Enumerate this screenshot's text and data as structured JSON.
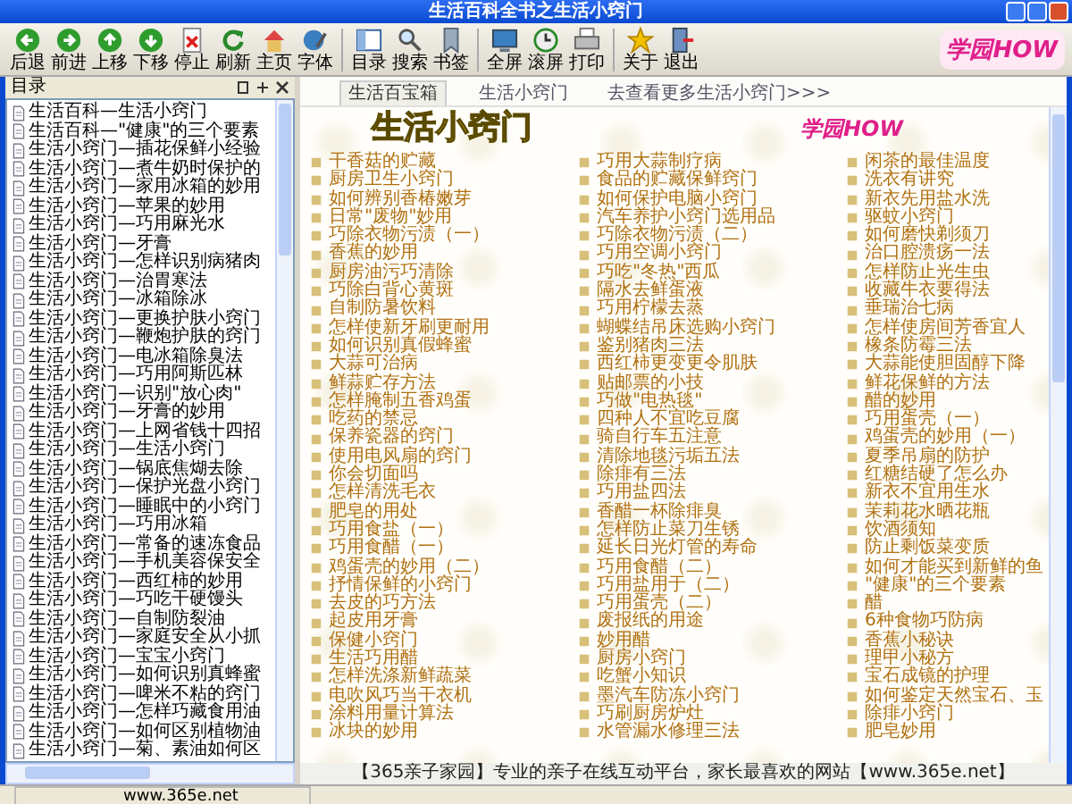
{
  "window": {
    "title": "生活百科全书之生活小窍门"
  },
  "toolbar": {
    "buttons": [
      {
        "label": "后退"
      },
      {
        "label": "前进"
      },
      {
        "label": "上移"
      },
      {
        "label": "下移"
      },
      {
        "label": "停止"
      },
      {
        "label": "刷新"
      },
      {
        "label": "主页"
      },
      {
        "label": "字体"
      },
      {
        "label": "目录"
      },
      {
        "label": "搜索"
      },
      {
        "label": "书签"
      },
      {
        "label": "全屏"
      },
      {
        "label": "滚屏"
      },
      {
        "label": "打印"
      },
      {
        "label": "关于"
      },
      {
        "label": "退出"
      }
    ],
    "logo": "学园HOW"
  },
  "sidebar": {
    "title": "目录",
    "items": [
      "生活百科—生活小窍门",
      "生活百科—\"健康\"的三个要素",
      "生活小窍门—插花保鲜小经验",
      "生活小窍门—煮牛奶时保护的",
      "生活小窍门—家用冰箱的妙用",
      "生活小窍门—苹果的妙用",
      "生活小窍门—巧用麻光水",
      "生活小窍门—牙膏",
      "生活小窍门—怎样识别病猪肉",
      "生活小窍门—治胃寒法",
      "生活小窍门—冰箱除冰",
      "生活小窍门—更换护肤小窍门",
      "生活小窍门—鞭炮护肤的窍门",
      "生活小窍门—电冰箱除臭法",
      "生活小窍门—巧用阿斯匹林",
      "生活小窍门—识别\"放心肉\"",
      "生活小窍门—牙膏的妙用",
      "生活小窍门—上网省钱十四招",
      "生活小窍门—生活小窍门",
      "生活小窍门—锅底焦煳去除",
      "生活小窍门—保护光盘小窍门",
      "生活小窍门—睡眠中的小窍门",
      "生活小窍门—巧用冰箱",
      "生活小窍门—常备的速冻食品",
      "生活小窍门—手机美容保安全",
      "生活小窍门—西红柿的妙用",
      "生活小窍门—巧吃干硬馒头",
      "生活小窍门—自制防裂油",
      "生活小窍门—家庭安全从小抓",
      "生活小窍门—宝宝小窍门",
      "生活小窍门—如何识别真蜂蜜",
      "生活小窍门—啤米不粘的窍门",
      "生活小窍门—怎样巧藏食用油",
      "生活小窍门—如何区别植物油",
      "生活小窍门—菊、素油如何区"
    ]
  },
  "tabs": [
    {
      "label": "生活百宝箱",
      "selected": true
    },
    {
      "label": "生活小窍门",
      "selected": false
    },
    {
      "label": "去查看更多生活小窍门>>>",
      "selected": false
    }
  ],
  "content": {
    "banner_title": "生活小窍门",
    "site_logo": "学园HOW",
    "columns": [
      [
        "干香菇的贮藏",
        "厨房卫生小窍门",
        "如何辨别香椿嫩芽",
        "日常\"废物\"妙用",
        "巧除衣物污渍（一）",
        "香蕉的妙用",
        "厨房油污巧清除",
        "巧除白背心黄斑",
        "自制防暑饮料",
        "怎样使新牙刷更耐用",
        "如何识别真假蜂蜜",
        "大蒜可治病",
        "鲜蒜贮存方法",
        "怎样腌制五香鸡蛋",
        "吃药的禁忌",
        "保养瓷器的窍门",
        "使用电风扇的窍门",
        "你会切面吗",
        "怎样清洗毛衣",
        "肥皂的用处",
        "巧用食盐（一）",
        "巧用食醋（一）",
        "鸡蛋壳的妙用（二）",
        "抒情保鲜的小窍门",
        "去皮的巧方法",
        "起皮用牙膏",
        "保健小窍门",
        "生活巧用醋",
        "怎样洗涤新鲜蔬菜",
        "电吹风巧当干衣机",
        "涂料用量计算法",
        "冰块的妙用"
      ],
      [
        "巧用大蒜制疗病",
        "食品的贮藏保鲜窍门",
        "如何保护电脑小窍门",
        "汽车养护小窍门选用品",
        "巧除衣物污渍（二）",
        "巧用空调小窍门",
        "巧吃\"冬热\"西瓜",
        "隔水去鲜蛋液",
        "巧用柠檬去蒸",
        "蝴蝶结吊床选购小窍门",
        "鉴别猪肉三法",
        "西红柿更变更令肌肤",
        "贴邮票的小技",
        "巧做\"电热毯\"",
        "四种人不宜吃豆腐",
        "骑自行车五注意",
        "清除地毯污垢五法",
        "除痱有三法",
        "巧用盐四法",
        "香醋一杯除痱臭",
        "怎样防止菜刀生锈",
        "延长日光灯管的寿命",
        "巧用食醋（二）",
        "巧用盐用于（二）",
        "巧用蛋壳（二）",
        "废报纸的用途",
        "妙用醋",
        "厨房小窍门",
        "吃蟹小知识",
        "墨汽车防冻小窍门",
        "巧刷厨房炉灶",
        "水管漏水修理三法"
      ],
      [
        "闲茶的最佳温度",
        "洗衣有讲究",
        "新衣先用盐水洗",
        "驱蚊小窍门",
        "如何磨快剃须刀",
        "治口腔溃疡一法",
        "怎样防止光生虫",
        "收藏牛衣要得法",
        "垂瑞治七病",
        "怎样使房间芳香宜人",
        "橡条防霉三法",
        "大蒜能使胆固醇下降",
        "鲜花保鲜的方法",
        "醋的妙用",
        "巧用蛋壳（一）",
        "鸡蛋壳的妙用（一）",
        "夏季吊扇的防护",
        "红糖结硬了怎么办",
        "新衣不宜用生水",
        "茉莉花水晒花瓶",
        "饮酒须知",
        "防止剩饭菜变质",
        "如何才能买到新鲜的鱼",
        "\"健康\"的三个要素",
        "醋",
        "6种食物巧防病",
        "香蕉小秘诀",
        "理甲小秘方",
        "宝石成镜的护理",
        "如何鉴定天然宝石、玉",
        "除痱小窍门",
        "肥皂妙用"
      ]
    ],
    "footer": "【365亲子家园】专业的亲子在线互动平台，家长最喜欢的网站【www.365e.net】"
  },
  "status_bar": {
    "text": "www.365e.net"
  }
}
